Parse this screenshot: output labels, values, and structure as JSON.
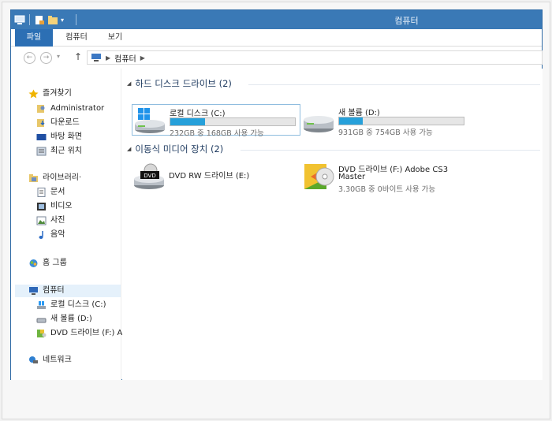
{
  "window": {
    "title": "컴퓨터"
  },
  "ribbon": {
    "tabs": [
      {
        "label": "파일"
      },
      {
        "label": "컴퓨터"
      },
      {
        "label": "보기"
      }
    ]
  },
  "address": {
    "crumb": "컴퓨터"
  },
  "sidebar": {
    "favorites": {
      "label": "즐겨찾기",
      "items": [
        {
          "label": "Administrator"
        },
        {
          "label": "다운로드"
        },
        {
          "label": "바탕 화면"
        },
        {
          "label": "최근 위치"
        }
      ]
    },
    "libraries": {
      "label": "라이브러리·",
      "items": [
        {
          "label": "문서"
        },
        {
          "label": "비디오"
        },
        {
          "label": "사진"
        },
        {
          "label": "음악"
        }
      ]
    },
    "homegroup": {
      "label": "홈 그룹"
    },
    "computer": {
      "label": "컴퓨터",
      "items": [
        {
          "label": "로컬 디스크 (C:)"
        },
        {
          "label": "새 볼륨 (D:)"
        },
        {
          "label": "DVD 드라이브 (F:) A"
        }
      ]
    },
    "network": {
      "label": "네트워크"
    }
  },
  "groups": {
    "hdd": {
      "header": "하드 디스크 드라이브 (2)",
      "drives": [
        {
          "name": "로컬 디스크 (C:)",
          "info": "232GB 중 168GB 사용 가능",
          "used_fraction": 0.28
        },
        {
          "name": "새 볼륨 (D:)",
          "info": "931GB 중 754GB 사용 가능",
          "used_fraction": 0.19
        }
      ]
    },
    "removable": {
      "header": "이동식 미디어 장치 (2)",
      "drives": [
        {
          "name": "DVD RW 드라이브 (E:)"
        },
        {
          "name": "DVD 드라이브 (F:) Adobe CS3",
          "name2": "Master",
          "info": "3.30GB 중 0바이트 사용 가능"
        }
      ]
    }
  },
  "colors": {
    "titlebar": "#3a79b6",
    "file_tab": "#2c6fb4",
    "progress": "#26a0da"
  }
}
